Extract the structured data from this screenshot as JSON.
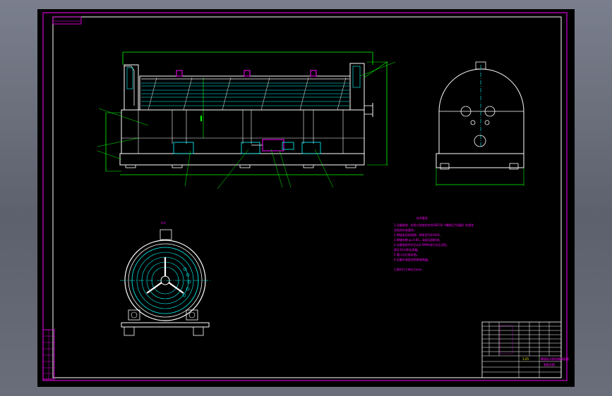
{
  "drawing": {
    "background_color": "#000000",
    "frame_color": "#ff00ff",
    "outline_color": "#ffffff",
    "centerline_color": "#00ffff",
    "dimension_color": "#00ff00",
    "notes_color": "#ff00ff"
  },
  "notes": {
    "heading": "技术要求",
    "lines": [
      "1.设备制造、检验与验收应符合GB150《钢制压力容器》的规定",
      "  及相关标准要求。",
      "2.焊接采用电弧焊，焊条型号E4303。",
      "3.焊缝系数 φ=0.85，局部无损检测。",
      "4.设备制造完毕后以0.5MPa进行水压试验，",
      "  保压30分钟无渗漏。",
      "5.管口方位按本图。",
      "6.设备外表面涂防锈漆两遍。"
    ],
    "footer": "1.图中尺寸单位为mm"
  },
  "view_label": "A-A",
  "title_block": {
    "drawing_title": "螺旋板式换热器装配图",
    "scale": "1:25",
    "sheet": "装配总图"
  }
}
